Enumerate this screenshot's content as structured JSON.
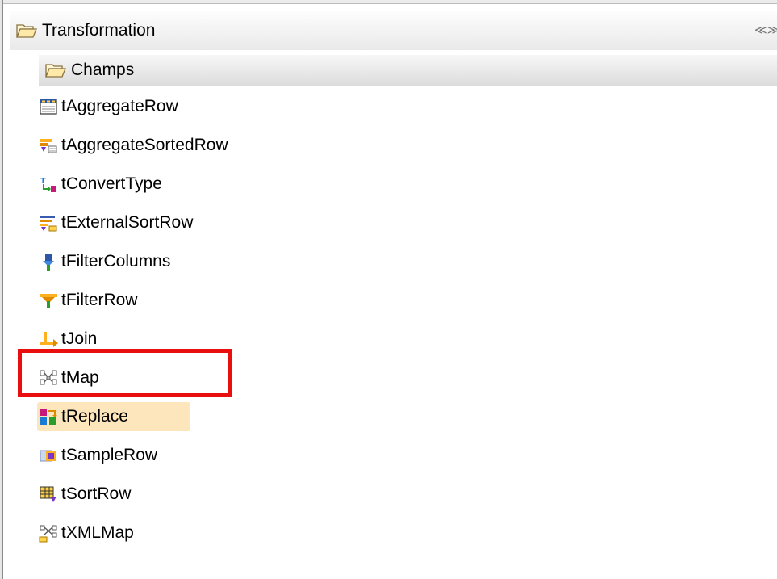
{
  "panel": {
    "category_label": "Transformation",
    "collapse_glyph": "≪≫",
    "folder_label": "Champs"
  },
  "items": [
    {
      "label": "tAggregateRow",
      "icon": "aggregate-row-icon"
    },
    {
      "label": "tAggregateSortedRow",
      "icon": "aggregate-sorted-row-icon"
    },
    {
      "label": "tConvertType",
      "icon": "convert-type-icon"
    },
    {
      "label": "tExternalSortRow",
      "icon": "external-sort-row-icon"
    },
    {
      "label": "tFilterColumns",
      "icon": "filter-columns-icon"
    },
    {
      "label": "tFilterRow",
      "icon": "filter-row-icon"
    },
    {
      "label": "tJoin",
      "icon": "join-icon"
    },
    {
      "label": "tMap",
      "icon": "map-icon"
    },
    {
      "label": "tReplace",
      "icon": "replace-icon"
    },
    {
      "label": "tSampleRow",
      "icon": "sample-row-icon"
    },
    {
      "label": "tSortRow",
      "icon": "sort-row-icon"
    },
    {
      "label": "tXMLMap",
      "icon": "xml-map-icon"
    }
  ],
  "colors": {
    "highlight_border": "#ea0f0f",
    "hover_background": "#fde6bc"
  }
}
